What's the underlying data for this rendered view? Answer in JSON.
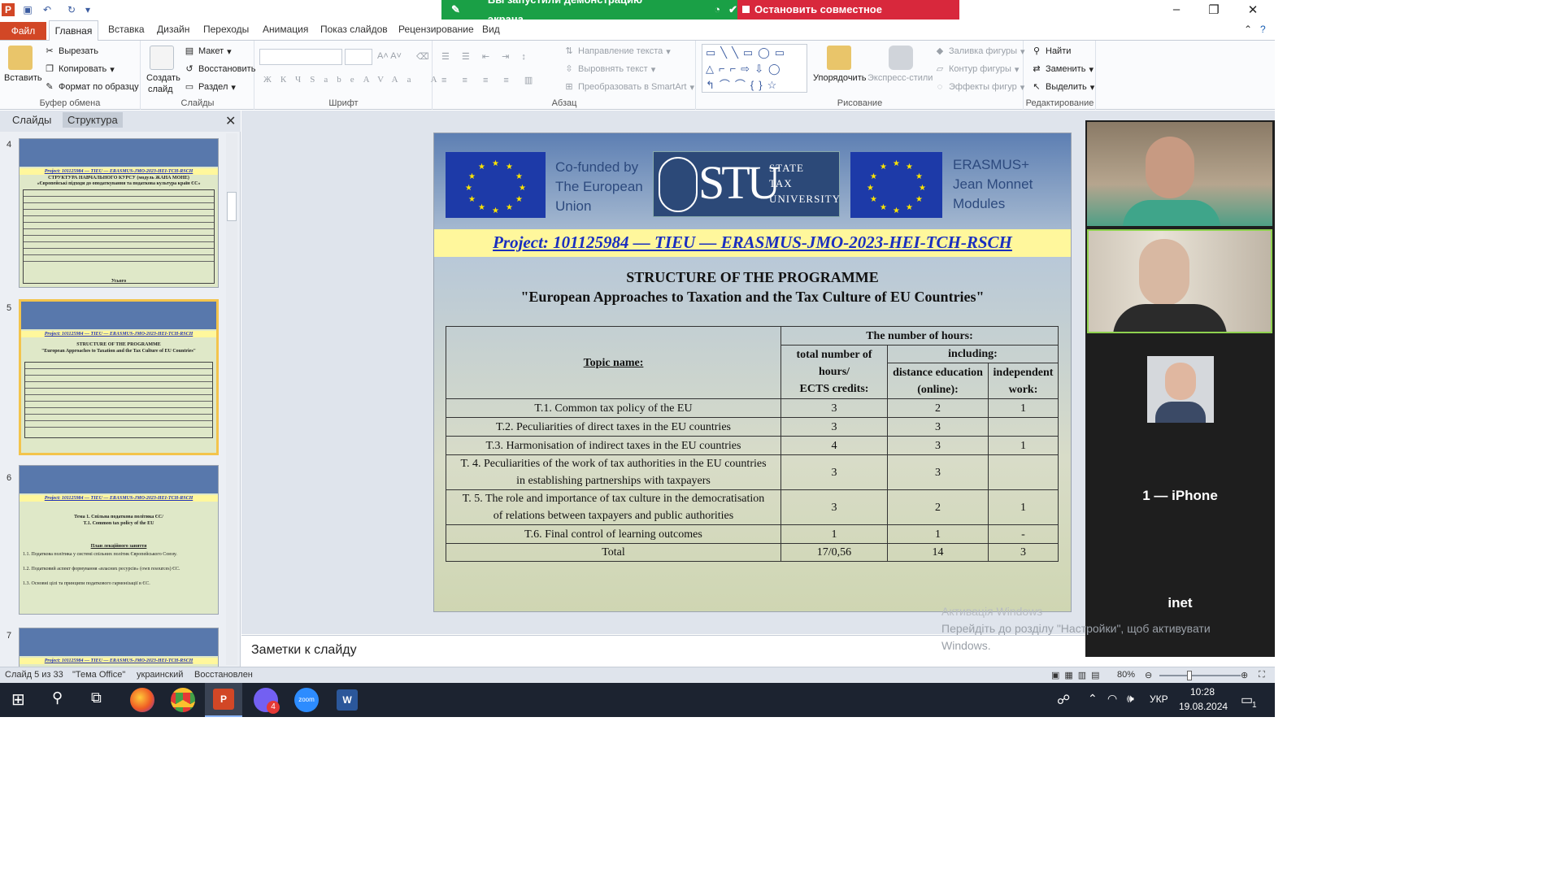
{
  "titlebar": {
    "share_status": "Вы запустили демонстрацию экрана",
    "stop_sharing": "Остановить совместное использование",
    "minimize": "–",
    "maximize": "❐",
    "close": "✕"
  },
  "ribbon_tabs": [
    "Файл",
    "Главная",
    "Вставка",
    "Дизайн",
    "Переходы",
    "Анимация",
    "Показ слайдов",
    "Рецензирование",
    "Вид"
  ],
  "ribbon": {
    "clipboard": {
      "paste": "Вставить",
      "cut": "Вырезать",
      "copy": "Копировать",
      "format_painter": "Формат по образцу",
      "label": "Буфер обмена"
    },
    "slides": {
      "new_slide_1": "Создать",
      "new_slide_2": "слайд",
      "layout": "Макет",
      "reset": "Восстановить",
      "section": "Раздел",
      "label": "Слайды"
    },
    "font": {
      "label": "Шрифт"
    },
    "paragraph": {
      "text_direction": "Направление текста",
      "align_text": "Выровнять текст",
      "smartart": "Преобразовать в SmartArt",
      "label": "Абзац"
    },
    "drawing": {
      "arrange": "Упорядочить",
      "quick_styles": "Экспресс-стили",
      "shape_fill": "Заливка фигуры",
      "shape_outline": "Контур фигуры",
      "shape_effects": "Эффекты фигур",
      "label": "Рисование"
    },
    "editing": {
      "find": "Найти",
      "replace": "Заменить",
      "select": "Выделить",
      "label": "Редактирование"
    }
  },
  "left_pane": {
    "tab_slides": "Слайды",
    "tab_outline": "Структура",
    "slide_numbers": [
      "4",
      "5",
      "6",
      "7"
    ],
    "thumb4_project": "Project: 101125984 — TIEU — ERASMUS-JMO-2023-HEI-TCH-RSCH",
    "thumb4_title": "СТРУКТУРА НАВЧАЛЬНОГО КУРСУ (модуль ЖАНА МОНЕ)",
    "thumb4_subtitle": "«Європейські підходи до оподаткування та податкова культура країн ЄС»",
    "thumb4_total": "Усього",
    "thumb6_title": "Тема 1. Спільна податкова політика ЄС/",
    "thumb6_title2": "T.1. Common tax policy of the EU",
    "thumb6_plan": "План лекційного заняття",
    "thumb6_items": [
      "1.1. Податкова політика у системі спільних політик Європейського Союзу.",
      "1.2. Податковий аспект формування «власних ресурсів» (own resources) ЄС.",
      "1.3. Основні цілі та принципи податкового гармонізації в ЄС."
    ]
  },
  "slide": {
    "cofunded": [
      "Co-funded by",
      "The European",
      "Union"
    ],
    "stu": "STU",
    "stu_words": [
      "STATE",
      "TAX",
      "UNIVERSITY"
    ],
    "erasmus": [
      "ERASMUS+",
      "Jean Monnet",
      "Modules"
    ],
    "project": "Project: 101125984 — TIEU — ERASMUS-JMO-2023-HEI-TCH-RSCH",
    "title_1": "STRUCTURE  OF THE PROGRAMME",
    "title_2": "\"European Approaches to Taxation and the Tax Culture of EU Countries\"",
    "table": {
      "topic_header": "Topic name:",
      "hours_header": "The number of hours:",
      "total_header_1": "total number of",
      "total_header_2": "hours/",
      "total_header_3": "ECTS credits:",
      "including": "including:",
      "distance_1": "distance education",
      "distance_2": "(online):",
      "independent_1": "independent",
      "independent_2": "work:",
      "rows": [
        {
          "topic_1": "T.1. Common tax policy of the EU",
          "topic_2": "",
          "total": "3",
          "distance": "2",
          "independent": "1"
        },
        {
          "topic_1": "T.2. Peculiarities  of direct taxes in the EU countries",
          "topic_2": "",
          "total": "3",
          "distance": "3",
          "independent": ""
        },
        {
          "topic_1": "T.3. Harmonisation  of indirect  taxes in the EU countries",
          "topic_2": "",
          "total": "4",
          "distance": "3",
          "independent": "1"
        },
        {
          "topic_1": "T. 4. Peculiarities  of the work of tax authorities  in the EU countries",
          "topic_2": "in establishing partnerships with  taxpayers",
          "total": "3",
          "distance": "3",
          "independent": ""
        },
        {
          "topic_1": "T. 5. The role and importance of tax culture in  the democratisation",
          "topic_2": "of relations  between taxpayers and public authorities",
          "total": "3",
          "distance": "2",
          "independent": "1"
        },
        {
          "topic_1": "T.6. Final  control of learning  outcomes",
          "topic_2": "",
          "total": "1",
          "distance": "1",
          "independent": "-"
        }
      ],
      "total_row": {
        "label": "Total",
        "total": "17/0,56",
        "distance": "14",
        "independent": "3"
      }
    }
  },
  "notes_placeholder": "Заметки к слайду",
  "status": {
    "slide_counter": "Слайд 5 из 33",
    "theme": "\"Тема Office\"",
    "language": "украинский",
    "restored": "Восстановлен",
    "zoom": "80%"
  },
  "zoom_panel": {
    "participant_iphone": "1 — iPhone",
    "participant_inet": "inet"
  },
  "watermark": {
    "line1": "Активація Windows",
    "line2": "Перейдіть до розділу \"Настройки\", щоб активувати",
    "line3": "Windows."
  },
  "taskbar": {
    "language": "УКР",
    "time": "10:28",
    "date": "19.08.2024",
    "viber_badge": "4",
    "notifications": "1"
  },
  "colors": {
    "accent_file": "#d24726",
    "share_green": "#1aa046",
    "share_red": "#d8283c",
    "project_link": "#1a2fbf"
  }
}
